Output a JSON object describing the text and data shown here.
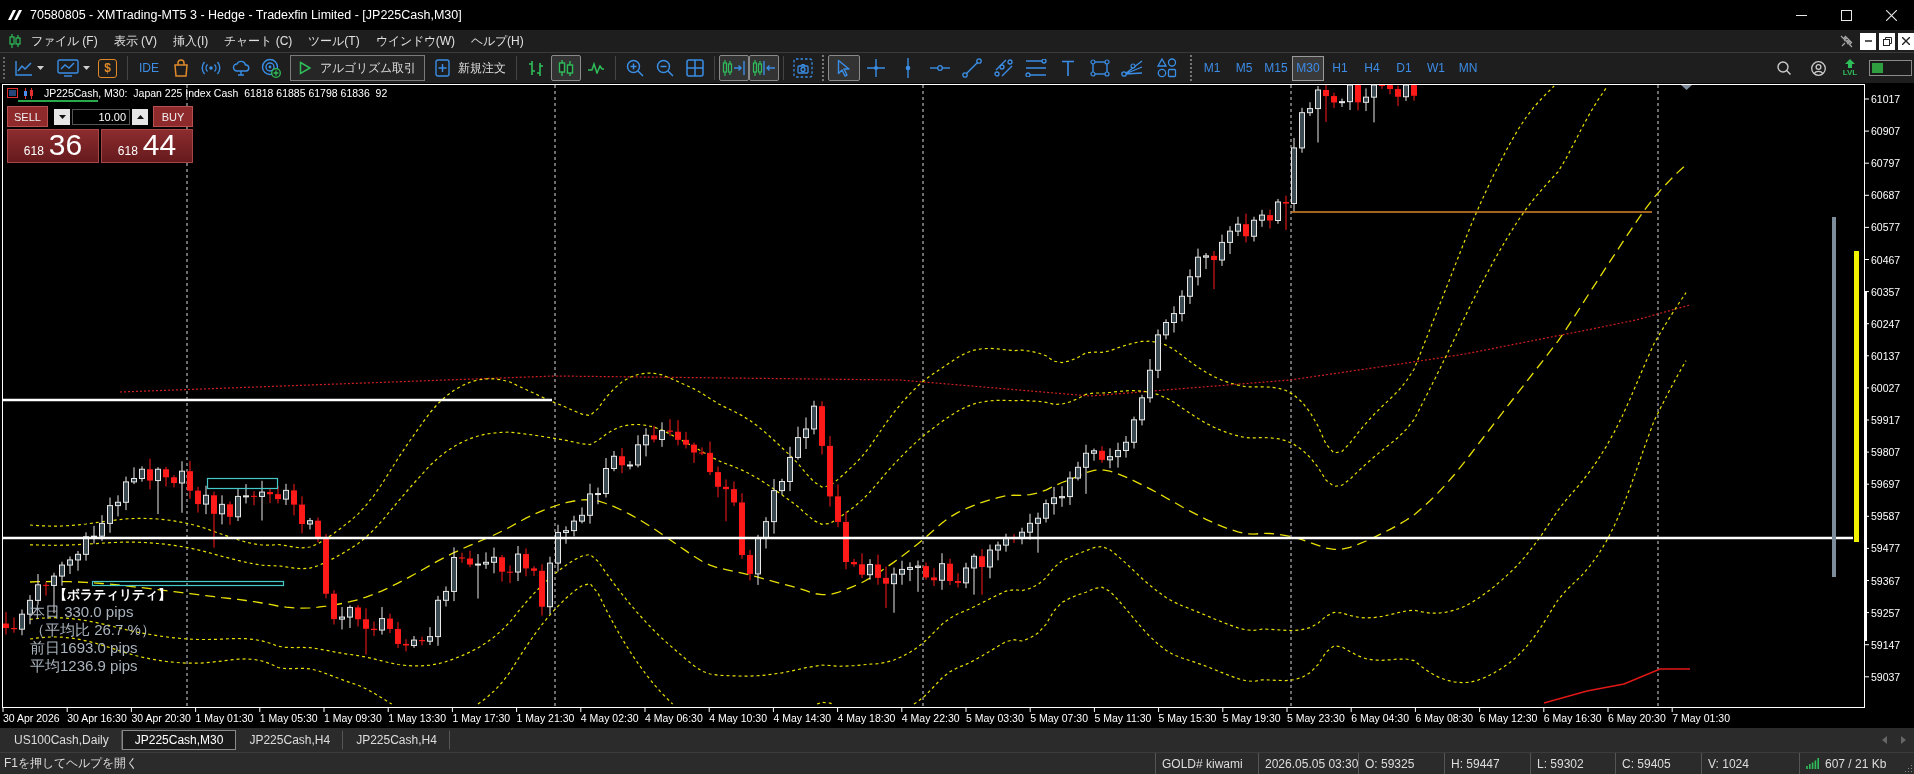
{
  "window": {
    "title": "70580805 - XMTrading-MT5 3 - Hedge - Tradexfin Limited - [JP225Cash,M30]"
  },
  "menu": [
    "ファイル (F)",
    "表示 (V)",
    "挿入(I)",
    "チャート (C)",
    "ツール(T)",
    "ウインドウ(W)",
    "ヘルプ(H)"
  ],
  "toolbar": {
    "market_watch_symbol": "$",
    "ide_label": "IDE",
    "algo_trading": "アルゴリズム取引",
    "new_order": "新規注文",
    "chart_types": [
      {
        "selected": false
      },
      {
        "selected": true
      },
      {
        "selected": false
      }
    ],
    "scroll_toggles": [
      {
        "selected": true
      },
      {
        "selected": true
      }
    ],
    "drawing_tools": [
      {
        "selected": true
      },
      {
        "selected": false
      },
      {
        "selected": false
      },
      {
        "selected": false
      },
      {
        "selected": false
      },
      {
        "selected": false
      },
      {
        "selected": false
      },
      {
        "selected": false
      },
      {
        "selected": false
      },
      {
        "selected": false
      },
      {
        "selected": false
      }
    ],
    "timeframes": [
      {
        "label": "M1",
        "selected": false
      },
      {
        "label": "M5",
        "selected": false
      },
      {
        "label": "M15",
        "selected": false
      },
      {
        "label": "M30",
        "selected": true
      },
      {
        "label": "H1",
        "selected": false
      },
      {
        "label": "H4",
        "selected": false
      },
      {
        "label": "D1",
        "selected": false
      },
      {
        "label": "W1",
        "selected": false
      },
      {
        "label": "MN",
        "selected": false
      }
    ],
    "level_label": "LVL",
    "level": 0.3
  },
  "chart": {
    "header": "JP225Cash, M30:  Japan 225 Index Cash  61818 61885 61798 61836  92",
    "trade_panel": {
      "sell_label": "SELL",
      "buy_label": "BUY",
      "volume": "10.00",
      "sell_price": {
        "prefix": "618",
        "main": "36"
      },
      "buy_price": {
        "prefix": "618",
        "main": "44"
      }
    },
    "volatility": {
      "title": "【ボラティリティ】",
      "lines": [
        "本日 330.0 pips",
        "（平均比 26.7 %）",
        "前日1693.0 pips",
        "平均1236.9 pips"
      ]
    },
    "price_axis": [
      "61017",
      "60907",
      "60797",
      "60687",
      "60577",
      "60467",
      "60357",
      "60247",
      "60137",
      "60027",
      "59917",
      "59807",
      "59697",
      "59587",
      "59477",
      "59367",
      "59257",
      "59147",
      "59037"
    ],
    "time_axis": [
      "30 Apr 2026",
      "30 Apr 16:30",
      "30 Apr 20:30",
      "1 May 01:30",
      "1 May 05:30",
      "1 May 09:30",
      "1 May 13:30",
      "1 May 17:30",
      "1 May 21:30",
      "4 May 02:30",
      "4 May 06:30",
      "4 May 10:30",
      "4 May 14:30",
      "4 May 18:30",
      "4 May 22:30",
      "5 May 03:30",
      "5 May 07:30",
      "5 May 11:30",
      "5 May 15:30",
      "5 May 19:30",
      "5 May 23:30",
      "6 May 04:30",
      "6 May 08:30",
      "6 May 12:30",
      "6 May 16:30",
      "6 May 20:30",
      "7 May 01:30"
    ]
  },
  "tabs": [
    {
      "label": "US100Cash,Daily",
      "selected": false
    },
    {
      "label": "JP225Cash,M30",
      "selected": true
    },
    {
      "label": "JP225Cash,H4",
      "selected": false
    },
    {
      "label": "JP225Cash,H4",
      "selected": false
    }
  ],
  "status_bar": {
    "help": "F1を押してヘルプを開く",
    "fields": [
      "GOLD# kiwami",
      "2026.05.05 03:30",
      "O: 59325",
      "H: 59447",
      "L: 59302",
      "C: 59405",
      "V: 1024"
    ],
    "traffic": "607 / 21 Kb"
  }
}
